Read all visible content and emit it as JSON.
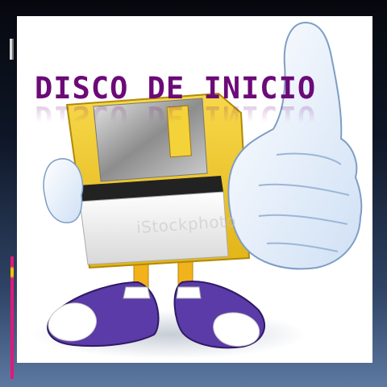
{
  "slide": {
    "title": "DISCO DE INICIO",
    "watermark_text": "iStockphoto"
  },
  "colors": {
    "title": "#6c0a78",
    "floppy_body": "#f0cb2a",
    "shoe": "#5b3ba8",
    "accent_pink": "#e2187a",
    "accent_yellow": "#f2c200"
  },
  "illustration": {
    "subject": "floppy disk mascot giving thumbs up",
    "icon": "floppy-disk-mascot-icon"
  }
}
